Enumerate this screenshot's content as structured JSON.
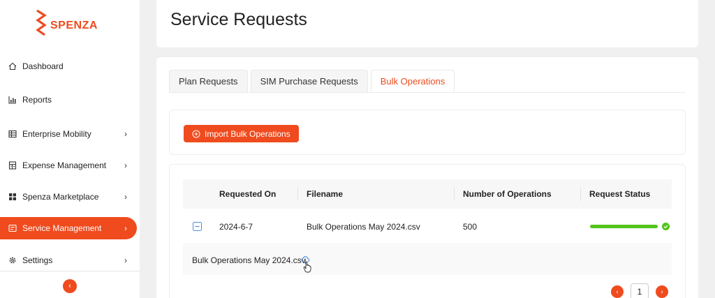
{
  "brand": {
    "name": "SPENZA",
    "color": "#ef4b1e"
  },
  "sidebar": {
    "items": [
      {
        "label": "Dashboard",
        "icon": "home-icon",
        "has_submenu": false,
        "active": false
      },
      {
        "label": "Reports",
        "icon": "bar-chart-icon",
        "has_submenu": false,
        "active": false
      },
      {
        "label": "Enterprise Mobility",
        "icon": "table-icon",
        "has_submenu": true,
        "active": false
      },
      {
        "label": "Expense Management",
        "icon": "calculator-icon",
        "has_submenu": true,
        "active": false
      },
      {
        "label": "Spenza Marketplace",
        "icon": "grid-icon",
        "has_submenu": true,
        "active": false
      },
      {
        "label": "Service Management",
        "icon": "ticket-icon",
        "has_submenu": true,
        "active": true
      },
      {
        "label": "Settings",
        "icon": "gear-icon",
        "has_submenu": true,
        "active": false
      }
    ],
    "collapse_icon": "chevron-left-icon"
  },
  "header": {
    "title": "Service Requests"
  },
  "tabs": [
    {
      "label": "Plan Requests",
      "active": false
    },
    {
      "label": "SIM Purchase Requests",
      "active": false
    },
    {
      "label": "Bulk Operations",
      "active": true
    }
  ],
  "import_button": {
    "label": "Import Bulk Operations",
    "icon": "plus-circle-icon"
  },
  "table": {
    "columns": [
      "Requested On",
      "Filename",
      "Number of Operations",
      "Request Status"
    ],
    "rows": [
      {
        "requested_on": "2024-6-7",
        "filename": "Bulk Operations May 2024.csv",
        "operations": "500",
        "status_progress": 1.0,
        "status_color": "#52c41a",
        "expanded": true,
        "detail_file": "Bulk Operations May 2024.csv"
      }
    ]
  },
  "pagination": {
    "current_page": "1",
    "prev_icon": "chevron-left-icon",
    "next_icon": "chevron-right-icon"
  }
}
